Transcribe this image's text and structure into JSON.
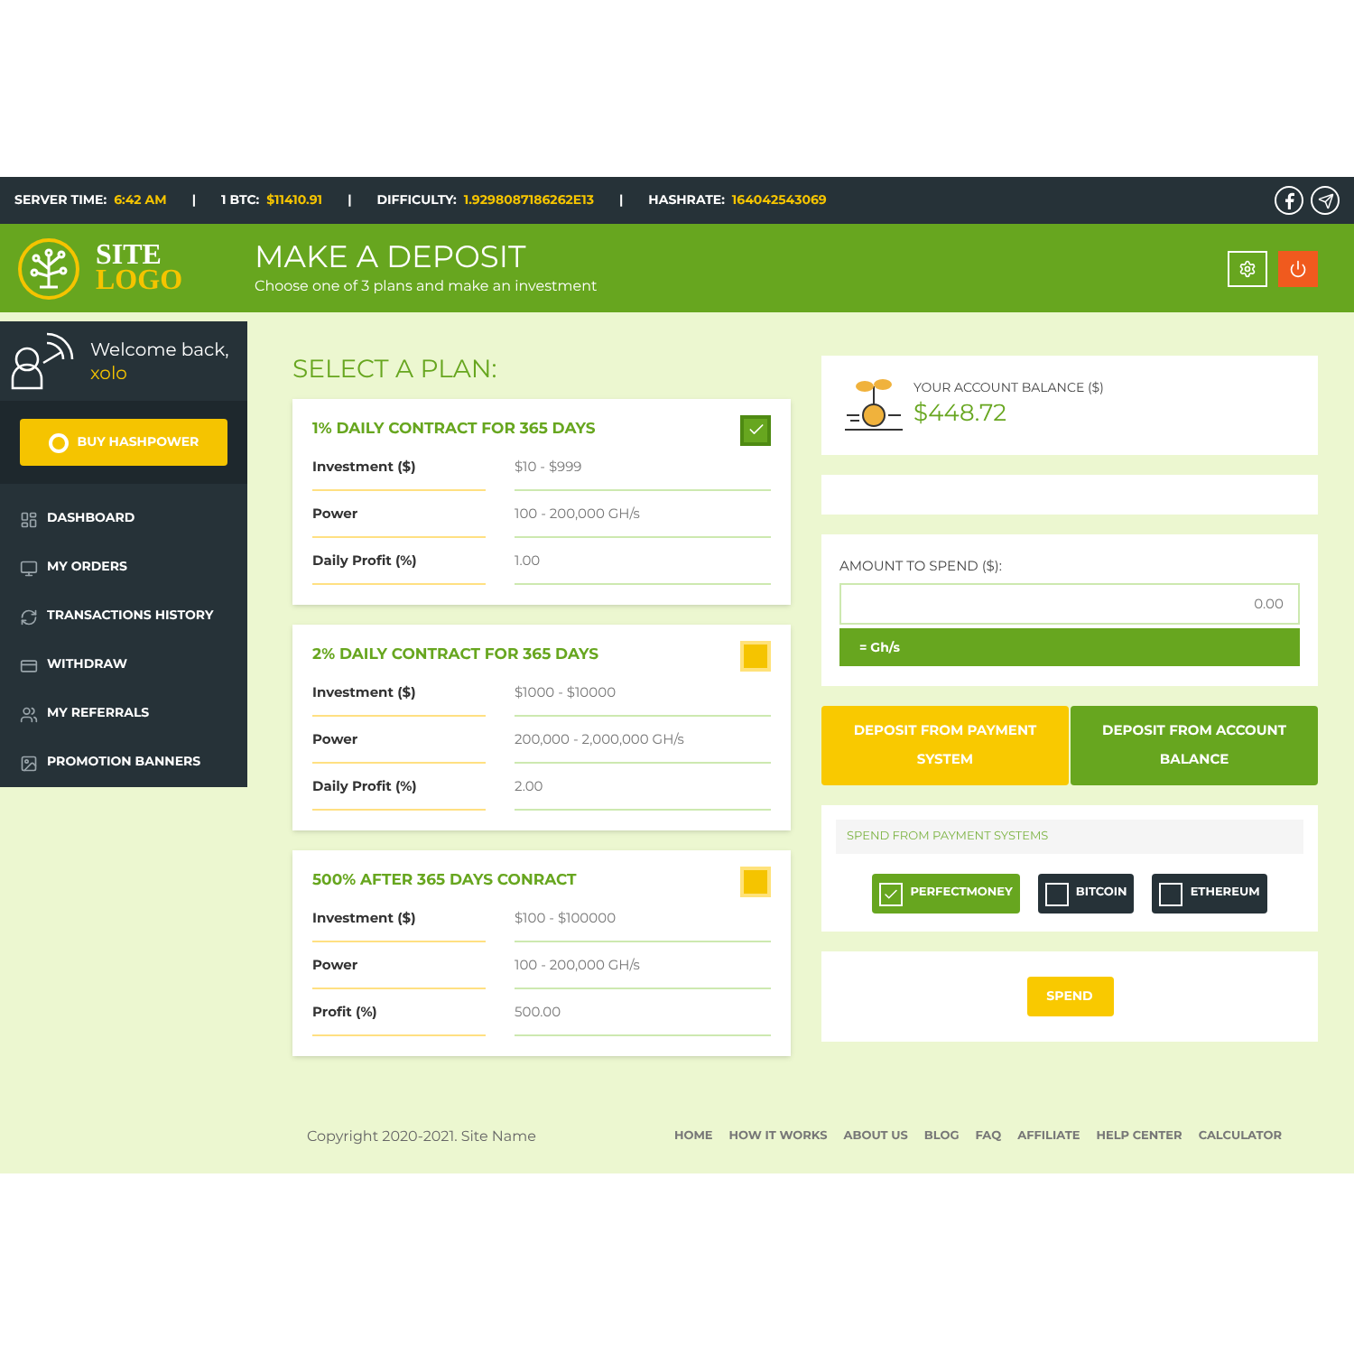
{
  "top_bar": {
    "stats": [
      {
        "label": "SERVER TIME:",
        "value": "6:42 AM"
      },
      {
        "label": "1 BTC:",
        "value": "$11410.91"
      },
      {
        "label": "DIFFICULTY:",
        "value": "1.9298087186262E13"
      },
      {
        "label": "HASHRATE:",
        "value": "164042543069"
      }
    ],
    "separator": "|"
  },
  "header": {
    "logo": {
      "line1": "SITE",
      "line2": "LOGO"
    },
    "title": "MAKE A DEPOSIT",
    "subtitle": "Choose one of 3 plans and make an investment"
  },
  "sidebar": {
    "welcome": "Welcome back,",
    "username": "xolo",
    "buy_button": "BUY HASHPOWER",
    "items": [
      {
        "label": "DASHBOARD",
        "kind": "dashboard"
      },
      {
        "label": "MY ORDERS",
        "kind": "monitor"
      },
      {
        "label": "TRANSACTIONS HISTORY",
        "kind": "refresh"
      },
      {
        "label": "WITHDRAW",
        "kind": "card"
      },
      {
        "label": "MY REFERRALS",
        "kind": "users"
      },
      {
        "label": "PROMOTION BANNERS",
        "kind": "image"
      }
    ]
  },
  "plans_heading": "SELECT A PLAN:",
  "plans": [
    {
      "title": "1% DAILY CONTRACT FOR 365 DAYS",
      "selected": true,
      "rows": [
        {
          "label": "Investment ($)",
          "value": "$10 - $999"
        },
        {
          "label": "Power",
          "value": "100 - 200,000 GH/s"
        },
        {
          "label": "Daily Profit (%)",
          "value": "1.00"
        }
      ]
    },
    {
      "title": "2% DAILY CONTRACT FOR 365 DAYS",
      "selected": false,
      "rows": [
        {
          "label": "Investment ($)",
          "value": "$1000 - $10000"
        },
        {
          "label": "Power",
          "value": "200,000 - 2,000,000 GH/s"
        },
        {
          "label": "Daily Profit (%)",
          "value": "2.00"
        }
      ]
    },
    {
      "title": "500% AFTER 365 DAYS CONRACT",
      "selected": false,
      "rows": [
        {
          "label": "Investment ($)",
          "value": "$100 - $100000"
        },
        {
          "label": "Power",
          "value": "100 - 200,000 GH/s"
        },
        {
          "label": "Profit (%)",
          "value": "500.00"
        }
      ]
    }
  ],
  "balance": {
    "label": "YOUR ACCOUNT BALANCE ($)",
    "value": "$448.72"
  },
  "amount": {
    "label": "AMOUNT TO SPEND ($):",
    "value": "0.00",
    "rate": "= Gh/s"
  },
  "deposit_tabs": [
    {
      "label": "DEPOSIT FROM PAYMENT SYSTEM",
      "selected": true
    },
    {
      "label": "DEPOSIT FROM ACCOUNT BALANCE",
      "selected": false
    }
  ],
  "payment": {
    "label": "SPEND FROM PAYMENT SYSTEMS",
    "options": [
      {
        "label": "PERFECTMONEY",
        "checked": true
      },
      {
        "label": "BITCOIN",
        "checked": false
      },
      {
        "label": "ETHEREUM",
        "checked": false
      }
    ]
  },
  "spend_button": "SPEND",
  "footer": {
    "copyright": "Copyright 2020-2021. Site Name",
    "links": [
      "HOME",
      "HOW IT WORKS",
      "ABOUT US",
      "BLOG",
      "FAQ",
      "AFFILIATE",
      "HELP CENTER",
      "CALCULATOR"
    ]
  }
}
